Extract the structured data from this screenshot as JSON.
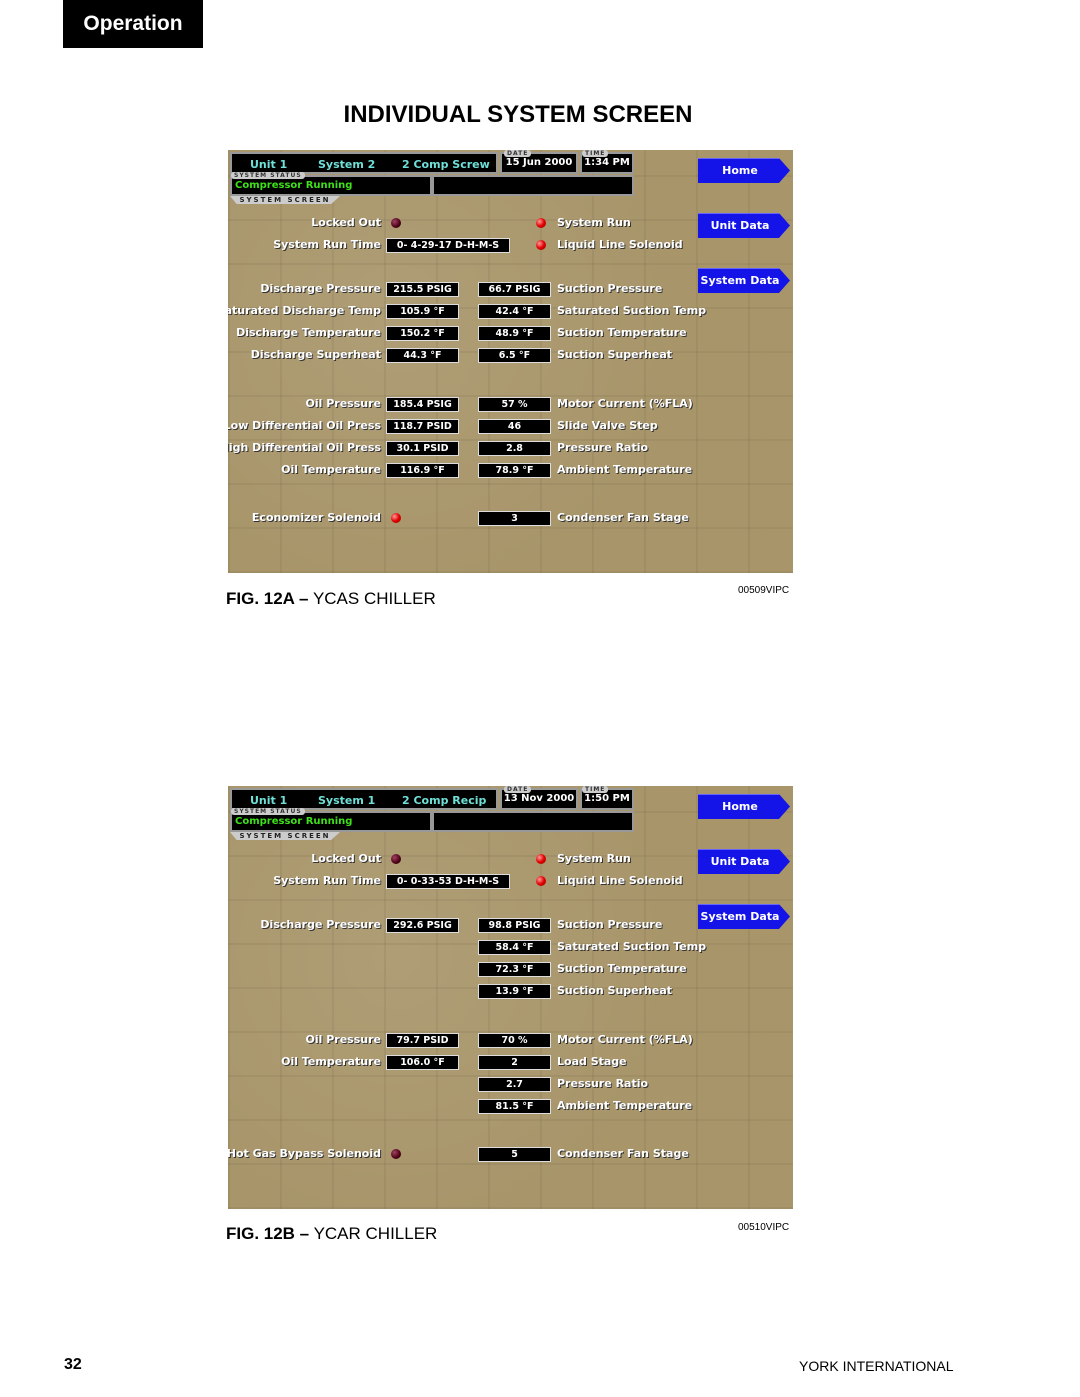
{
  "section_tab": "Operation",
  "title": "INDIVIDUAL SYSTEM SCREEN",
  "page_number": "32",
  "footer": "YORK INTERNATIONAL",
  "figures": [
    {
      "fig_label": "FIG. 12A –",
      "fig_name": "YCAS CHILLER",
      "code": "00509VIPC",
      "unit": "Unit 1",
      "system": "System 2",
      "type": "2 Comp Screw",
      "date_caption": "DATE",
      "date": "15 Jun 2000",
      "time_caption": "TIME",
      "time": "1:34 PM",
      "status_caption": "SYSTEM STATUS",
      "status": "Compressor Running",
      "screen_caption": "SYSTEM SCREEN",
      "nav": [
        "Home",
        "Unit Data",
        "System Data"
      ],
      "groups": [
        {
          "left": [
            {
              "label": "Locked Out",
              "led": "off"
            },
            {
              "label": "System Run Time",
              "value": "0- 4-29-17 D-H-M-S"
            }
          ],
          "right": [
            {
              "label": "System Run",
              "led": "on"
            },
            {
              "label": "Liquid Line Solenoid",
              "led": "on"
            }
          ]
        },
        {
          "left": [
            {
              "label": "Discharge Pressure",
              "value": "215.5 PSIG"
            },
            {
              "label": "Saturated Discharge Temp",
              "value": "105.9 °F"
            },
            {
              "label": "Discharge Temperature",
              "value": "150.2 °F"
            },
            {
              "label": "Discharge Superheat",
              "value": "44.3 °F"
            }
          ],
          "right": [
            {
              "label": "Suction Pressure",
              "value": "66.7 PSIG"
            },
            {
              "label": "Saturated Suction Temp",
              "value": "42.4 °F"
            },
            {
              "label": "Suction Temperature",
              "value": "48.9 °F"
            },
            {
              "label": "Suction Superheat",
              "value": "6.5 °F"
            }
          ]
        },
        {
          "left": [
            {
              "label": "Oil Pressure",
              "value": "185.4 PSIG"
            },
            {
              "label": "Low Differential Oil Press",
              "value": "118.7 PSID"
            },
            {
              "label": "High Differential Oil Press",
              "value": "30.1 PSID"
            },
            {
              "label": "Oil Temperature",
              "value": "116.9 °F"
            }
          ],
          "right": [
            {
              "label": "Motor Current (%FLA)",
              "value": "57 %"
            },
            {
              "label": "Slide Valve Step",
              "value": "46"
            },
            {
              "label": "Pressure Ratio",
              "value": "2.8"
            },
            {
              "label": "Ambient Temperature",
              "value": "78.9 °F"
            }
          ]
        },
        {
          "left": [
            {
              "label": "Economizer Solenoid",
              "led": "on"
            }
          ],
          "right": [
            {
              "label": "Condenser Fan Stage",
              "value": "3"
            }
          ]
        }
      ]
    },
    {
      "fig_label": "FIG. 12B –",
      "fig_name": "YCAR CHILLER",
      "code": "00510VIPC",
      "unit": "Unit 1",
      "system": "System 1",
      "type": "2 Comp Recip",
      "date_caption": "DATE",
      "date": "13 Nov 2000",
      "time_caption": "TIME",
      "time": "1:50 PM",
      "status_caption": "SYSTEM STATUS",
      "status": "Compressor Running",
      "screen_caption": "SYSTEM SCREEN",
      "nav": [
        "Home",
        "Unit Data",
        "System Data"
      ],
      "groups": [
        {
          "left": [
            {
              "label": "Locked Out",
              "led": "off"
            },
            {
              "label": "System Run Time",
              "value": "0- 0-33-53 D-H-M-S"
            }
          ],
          "right": [
            {
              "label": "System Run",
              "led": "on"
            },
            {
              "label": "Liquid Line Solenoid",
              "led": "on"
            }
          ]
        },
        {
          "left": [
            {
              "label": "Discharge Pressure",
              "value": "292.6 PSIG"
            }
          ],
          "right": [
            {
              "label": "Suction Pressure",
              "value": "98.8 PSIG"
            },
            {
              "label": "Saturated Suction Temp",
              "value": "58.4 °F"
            },
            {
              "label": "Suction Temperature",
              "value": "72.3 °F"
            },
            {
              "label": "Suction Superheat",
              "value": "13.9 °F"
            }
          ]
        },
        {
          "left": [
            {
              "label": "Oil Pressure",
              "value": "79.7 PSID"
            },
            {
              "label": "Oil Temperature",
              "value": "106.0 °F"
            }
          ],
          "right": [
            {
              "label": "Motor Current (%FLA)",
              "value": "70 %"
            },
            {
              "label": "Load Stage",
              "value": "2"
            },
            {
              "label": "Pressure Ratio",
              "value": "2.7"
            },
            {
              "label": "Ambient Temperature",
              "value": "81.5 °F"
            }
          ]
        },
        {
          "left": [
            {
              "label": "Hot Gas Bypass Solenoid",
              "led": "off"
            }
          ],
          "right": [
            {
              "label": "Condenser Fan Stage",
              "value": "5"
            }
          ]
        }
      ]
    }
  ]
}
